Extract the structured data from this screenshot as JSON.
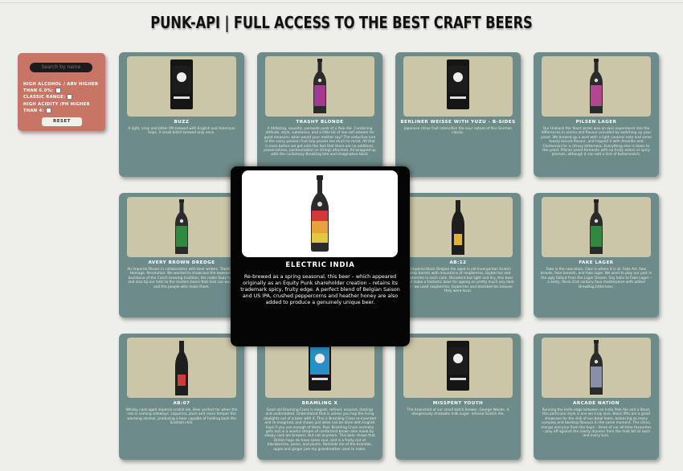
{
  "header": {
    "title": "PUNK-API | FULL ACCESS TO THE BEST CRAFT BEERS"
  },
  "filters": {
    "search_placeholder": "Search by name",
    "high_alcohol": "HIGH ALCOHOL / ABV HIGHER THAN 6.0%:",
    "classic_range": "CLASSIC RANGE:",
    "high_acidity": "HIGH ACIDITY /PH HIGHER THAN 4:",
    "reset_label": "RESET"
  },
  "beers": [
    {
      "name": "BUZZ",
      "label_color": "#1c1c1c",
      "description": "A light, crisp and bitter IPA brewed with English and American hops. A small batch brewed only once."
    },
    {
      "name": "TRASHY BLONDE",
      "label_color": "#a33a8f",
      "description": "A titillating, neurotic, peroxide punk of a Pale Ale. Combining attitude, style, substance, and a little bit of low self esteem for good measure; what would your mother say? The seductive lure of the sassy passion fruit hop proves too much to resist. All that is even before we get onto the fact that there are no additives, preservatives, pasteurization or strings attached. All wrapped up with the customary BrewDog bite and imaginative twist."
    },
    {
      "name": "BERLINER WEISSE WITH YUZU - B-SIDES",
      "label_color": "#1c1c1c",
      "description": "Japanese citrus fruit intensifies the sour nature of this German classic."
    },
    {
      "name": "PILSEN LAGER",
      "label_color": "#b0478f",
      "description": "Our Unleash the Yeast series was an epic experiment into the differences in aroma and flavour provided by switching up your yeast. We brewed up a wort with a light caramel note and some toasty biscuit flavour, and hopped it with Amarillo and Centennial for a citrusy bitterness. Everything else is down to the yeast. Pilsner yeast ferments with no fruity esters or spicy phenols, although it can add a hint of butterscotch."
    },
    {
      "name": "AVERY BROWN DREDGE",
      "label_color": "#2f8a3f",
      "description": "An Imperial Pilsner in collaboration with beer writers. Tradition. Homage. Revolution. We wanted to showcase the awesome backbone of the Czech brewing tradition, the noble Saaz hop, and also tip our hats to the modern beers that rock our world, and the people who make them."
    },
    {
      "name": "AB:12",
      "label_color": "#e1b23a",
      "description": "An Imperial Black Belgian Ale aged in old Invergordon Scotch whisky barrels with mountains of raspberries, tayberries and blackberries in each cask. Decadent but light and dry, this beer would make a fantastic base for ageing on pretty much any dark fruit - we used raspberries, tayberries and blackberries beause they were local."
    },
    {
      "name": "FAKE LAGER",
      "label_color": "#2f8a3f",
      "description": "Fake is the new black. Fake is where it is at. Fake Art, fake brands, fake breasts, and fake lager. We want to play our part in the ugly fallout from the Lager Dream. Say hello to Fake Lager – a zesty, floral 21st century faux masterpiece with added BrewDog bitterness."
    },
    {
      "name": "AB:07",
      "label_color": "#d23a3a",
      "description": "Whisky cask-aged imperial scotch ale. Beer perfect for when the rain is coming sideways. Liquorice, plum and raisin temper the warming alcohol, producing a beer capable of holding back the Scottish chill."
    },
    {
      "name": "BRAMLING X",
      "label_color": "#2a8fc7",
      "description": "Good old Bramling Cross is elegant, refined, assured, (boring) and understated. Understated that is unless you hop the living daylights out of a beer with it. This is Bramling Cross re-invented and re-imagined, and shows just what can be done with English hops if you use enough of them. Poor Bramling Cross normally gets lost in a woeful stream of conformist brown ales made by sleepy cask ale brewers. But not anymore. This beer shows that British hops do have some soul, and is a fruity riot of blackberries, pears, and plums. Reminds me of the bramble, apple and ginger jam my grandmother used to make."
    },
    {
      "name": "MISSPENT YOUTH",
      "label_color": "#1c1c1c",
      "description": "The brainchild of our small batch brewer, George Woods. A dangerously drinkable milk sugar- infused Scotch Ale."
    },
    {
      "name": "ARCADE NATION",
      "label_color": "#8a8fa8",
      "description": "Running the knife-edge between an India Pale Ale and a Stout, this particular style is one we truly love. Black IPAs are a great showcase for the skill of our brew team, balancing so many complex and twisting flavours in the same moment. The citrus, mango and pine from the hops – three of our all-time favourites – play off against the roasty dryness from the malt bill at each and every turn."
    }
  ],
  "modal": {
    "name": "ELECTRIC INDIA",
    "label_color": "#e8a23a",
    "description": "Re-brewed as a spring seasonal, this beer – which appeared originally as an Equity Punk shareholder creation – retains its trademark spicy, fruity edge. A perfect blend of Belgian Saison and US IPA, crushed peppercorns and heather honey are also added to produce a genuinely unique beer."
  }
}
